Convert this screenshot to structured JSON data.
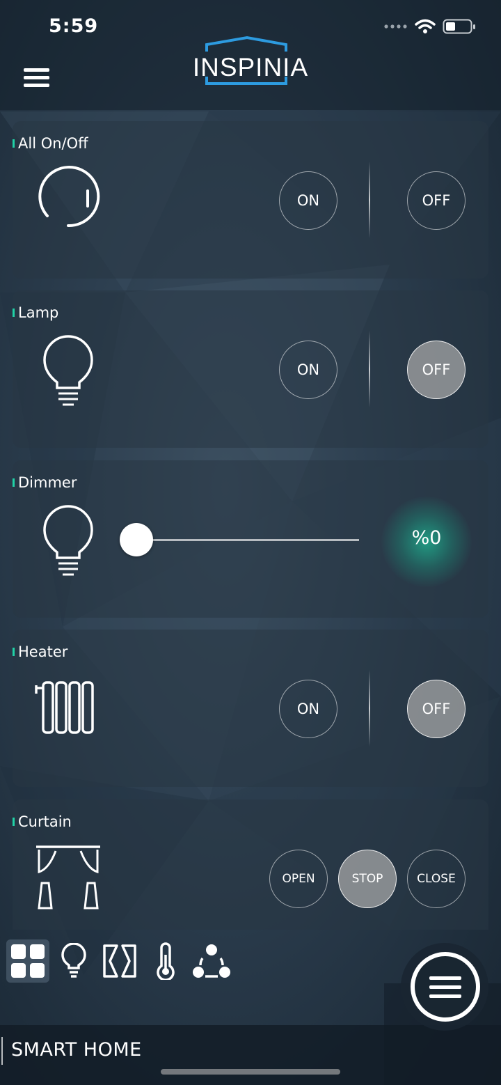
{
  "status_bar": {
    "time": "5:59"
  },
  "header": {
    "logo_text": "INSPINIA"
  },
  "cards": {
    "all": {
      "title": "All On/Off",
      "on_label": "ON",
      "off_label": "OFF",
      "active": "none"
    },
    "lamp": {
      "title": "Lamp",
      "on_label": "ON",
      "off_label": "OFF",
      "active": "off"
    },
    "dimmer": {
      "title": "Dimmer",
      "value_text": "%0",
      "level": 0
    },
    "heater": {
      "title": "Heater",
      "on_label": "ON",
      "off_label": "OFF",
      "active": "off"
    },
    "curtain": {
      "title": "Curtain",
      "open_label": "OPEN",
      "stop_label": "STOP",
      "close_label": "CLOSE",
      "active": "stop"
    }
  },
  "bottom_nav": {
    "items": [
      {
        "icon": "grid-icon",
        "active": true
      },
      {
        "icon": "bulb-icon",
        "active": false
      },
      {
        "icon": "curtain-icon",
        "active": false
      },
      {
        "icon": "thermometer-icon",
        "active": false
      },
      {
        "icon": "scenes-icon",
        "active": false
      }
    ]
  },
  "footer": {
    "label": "SMART HOME"
  },
  "colors": {
    "accent": "#21d1a6",
    "glow": "#20aa8c",
    "logo_blue": "#2d9be0"
  }
}
